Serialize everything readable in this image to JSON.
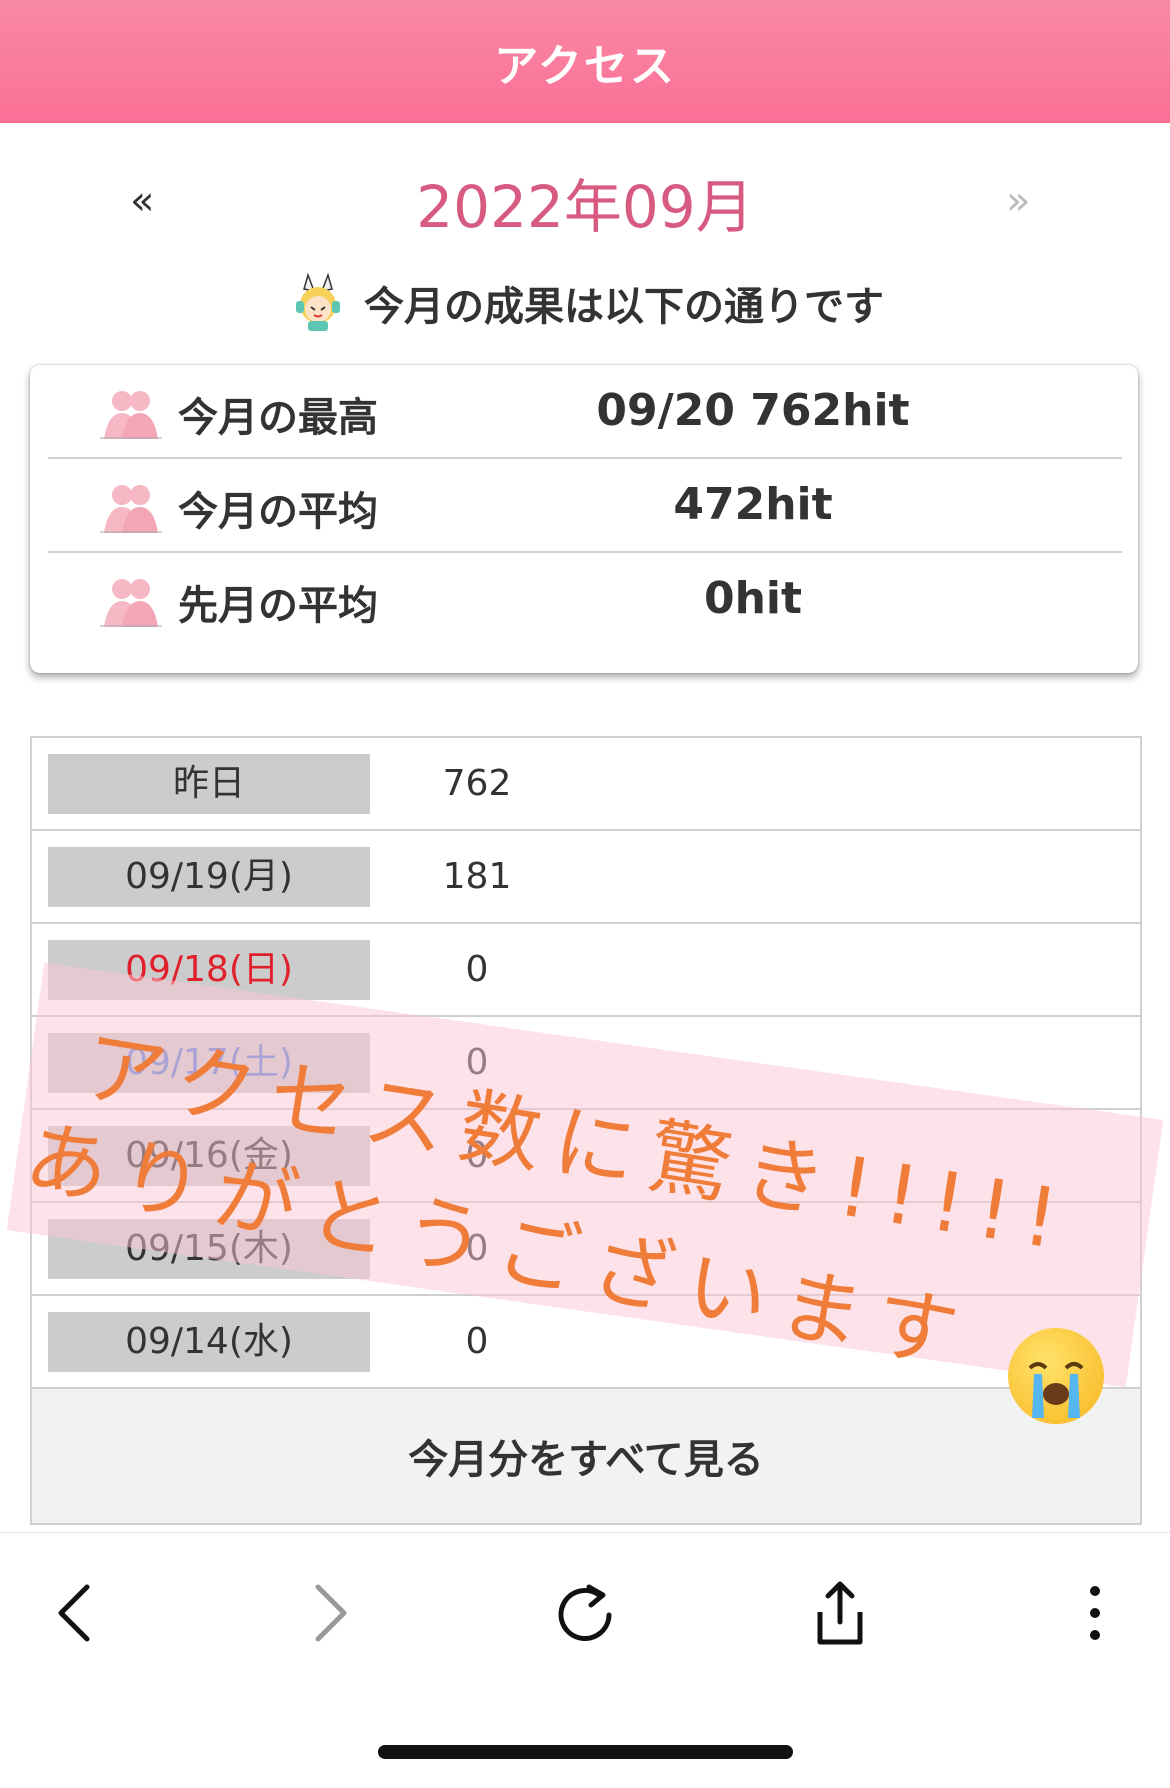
{
  "header": {
    "title": "アクセス"
  },
  "month_nav": {
    "prev_label": "«",
    "next_label": "»",
    "title": "2022年09月"
  },
  "intro": {
    "text": "今月の成果は以下の通りです"
  },
  "summary": [
    {
      "label": "今月の最高",
      "value": "09/20 762hit"
    },
    {
      "label": "今月の平均",
      "value": "472hit"
    },
    {
      "label": "先月の平均",
      "value": "0hit"
    }
  ],
  "daily": [
    {
      "label": "昨日",
      "value": "762"
    },
    {
      "label": "09/19(月)",
      "value": "181"
    },
    {
      "label": "09/18(日)",
      "value": "0"
    },
    {
      "label": "09/17(土)",
      "value": "0"
    },
    {
      "label": "09/16(金)",
      "value": "0"
    },
    {
      "label": "09/15(木)",
      "value": "0"
    },
    {
      "label": "09/14(水)",
      "value": "0"
    }
  ],
  "view_all_label": "今月分をすべて見る",
  "overlay": {
    "line1": "アクセス数に驚き!!!!!",
    "line2": "ありがとうございます"
  },
  "colors": {
    "header": "#fb7a9c",
    "month_title": "#d75a81",
    "sunday": "#e0212c",
    "saturday": "#5a7fd6",
    "overlay_text": "#f07c3a"
  },
  "icons": {
    "toolbar": [
      "back-icon",
      "forward-icon",
      "reload-icon",
      "share-icon",
      "more-icon"
    ],
    "summary": "person-icon",
    "intro": "mascot-icon",
    "overlay": "crying-face-emoji"
  }
}
